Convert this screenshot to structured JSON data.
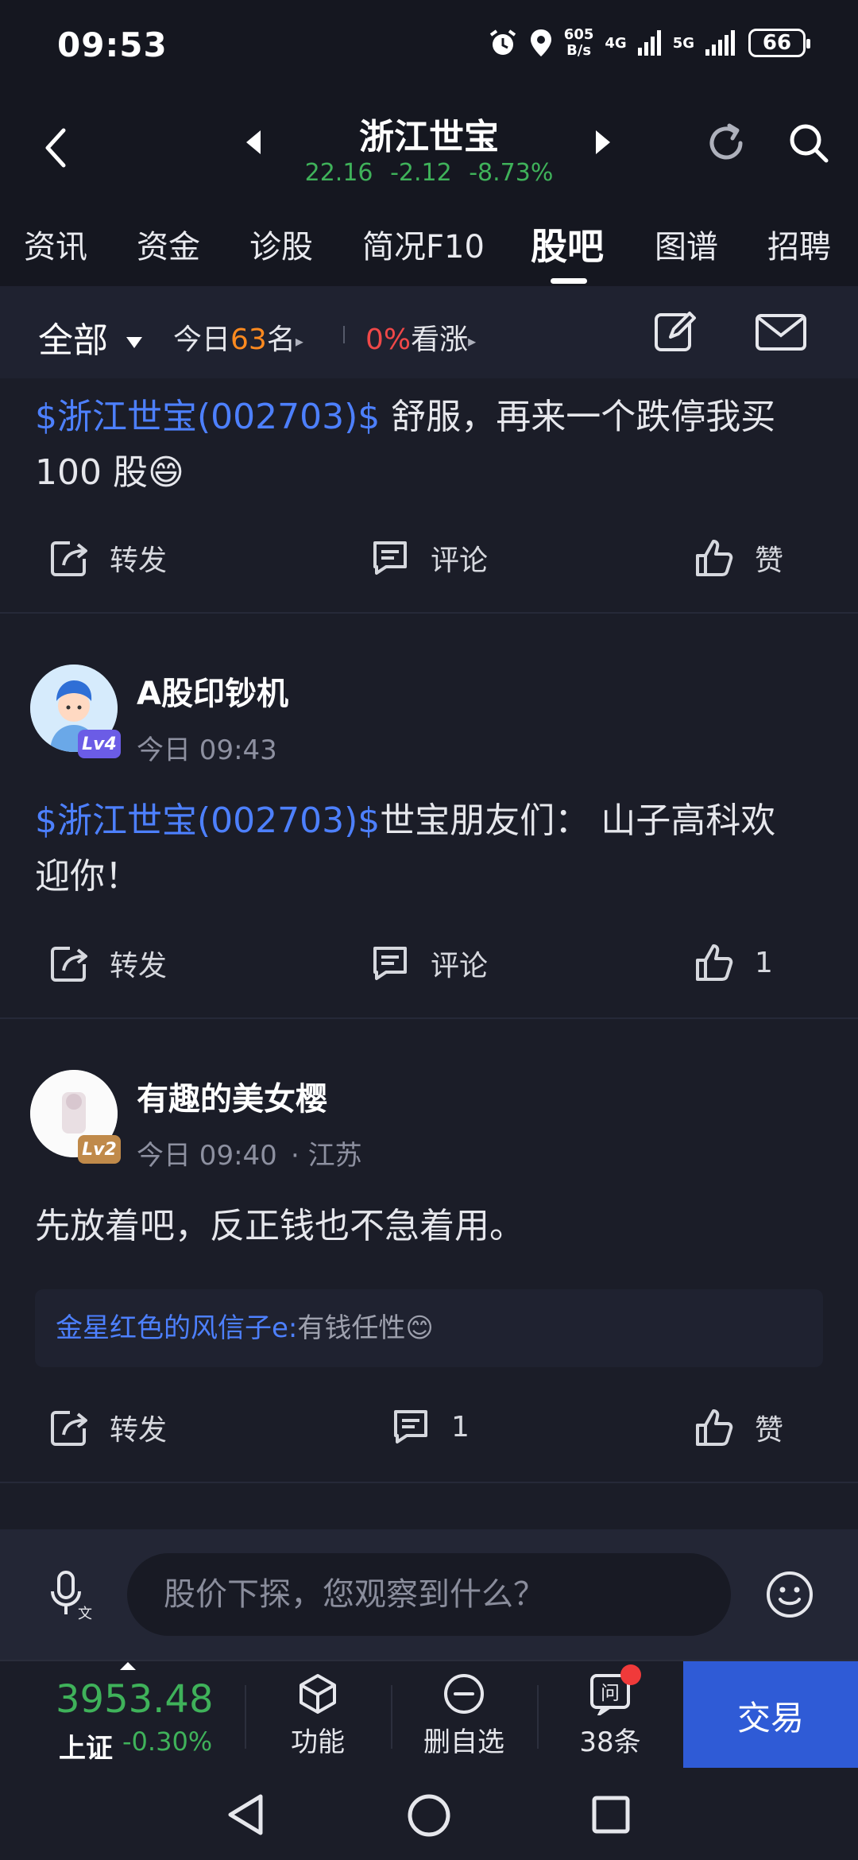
{
  "status_bar": {
    "time": "09:53",
    "net_speed_value": "605",
    "net_speed_unit": "B/s",
    "signal_1": "4G",
    "signal_2": "5G",
    "battery": "66"
  },
  "header": {
    "stock_name": "浙江世宝",
    "price": "22.16",
    "change": "-2.12",
    "change_pct": "-8.73%",
    "quote_color": "#3fb25a"
  },
  "tabs": [
    "资讯",
    "资金",
    "诊股",
    "简况F10",
    "股吧",
    "图谱",
    "招聘"
  ],
  "active_tab": "股吧",
  "filter_bar": {
    "all_label": "全部",
    "today_prefix": "今日",
    "today_rank": "63",
    "today_suffix": "名",
    "rise_pct": "0%",
    "rise_label": "看涨"
  },
  "posts": [
    {
      "mention": "$浙江世宝(002703)$",
      "text_line1": " 舒服，再来一个跌停我买",
      "text_line2": "100 股😄",
      "actions": {
        "share": "转发",
        "comment": "评论",
        "like": "赞"
      }
    },
    {
      "username": "A股印钞机",
      "level": "Lv4",
      "time": "今日 09:43",
      "mention": "$浙江世宝(002703)$",
      "text_line1": "世宝朋友们：  山子高科欢",
      "text_line2": "迎你！",
      "actions": {
        "share": "转发",
        "comment": "评论",
        "like": "1"
      }
    },
    {
      "username": "有趣的美女樱",
      "level": "Lv2",
      "time": "今日 09:40",
      "location": "· 江苏",
      "text": "先放着吧，反正钱也不急着用。",
      "reply": {
        "name": "金星红色的风信子e:",
        "text": "有钱任性😊"
      },
      "actions": {
        "share": "转发",
        "comment": "1",
        "like": "赞"
      }
    }
  ],
  "input_bar": {
    "placeholder": "股价下探，您观察到什么？"
  },
  "bottom_nav": {
    "index_value": "3953.48",
    "index_name": "上证",
    "index_change": "-0.30%",
    "items": [
      "功能",
      "删自选",
      "38条"
    ],
    "trade_label": "交易",
    "accent": "#2f5bd6"
  }
}
